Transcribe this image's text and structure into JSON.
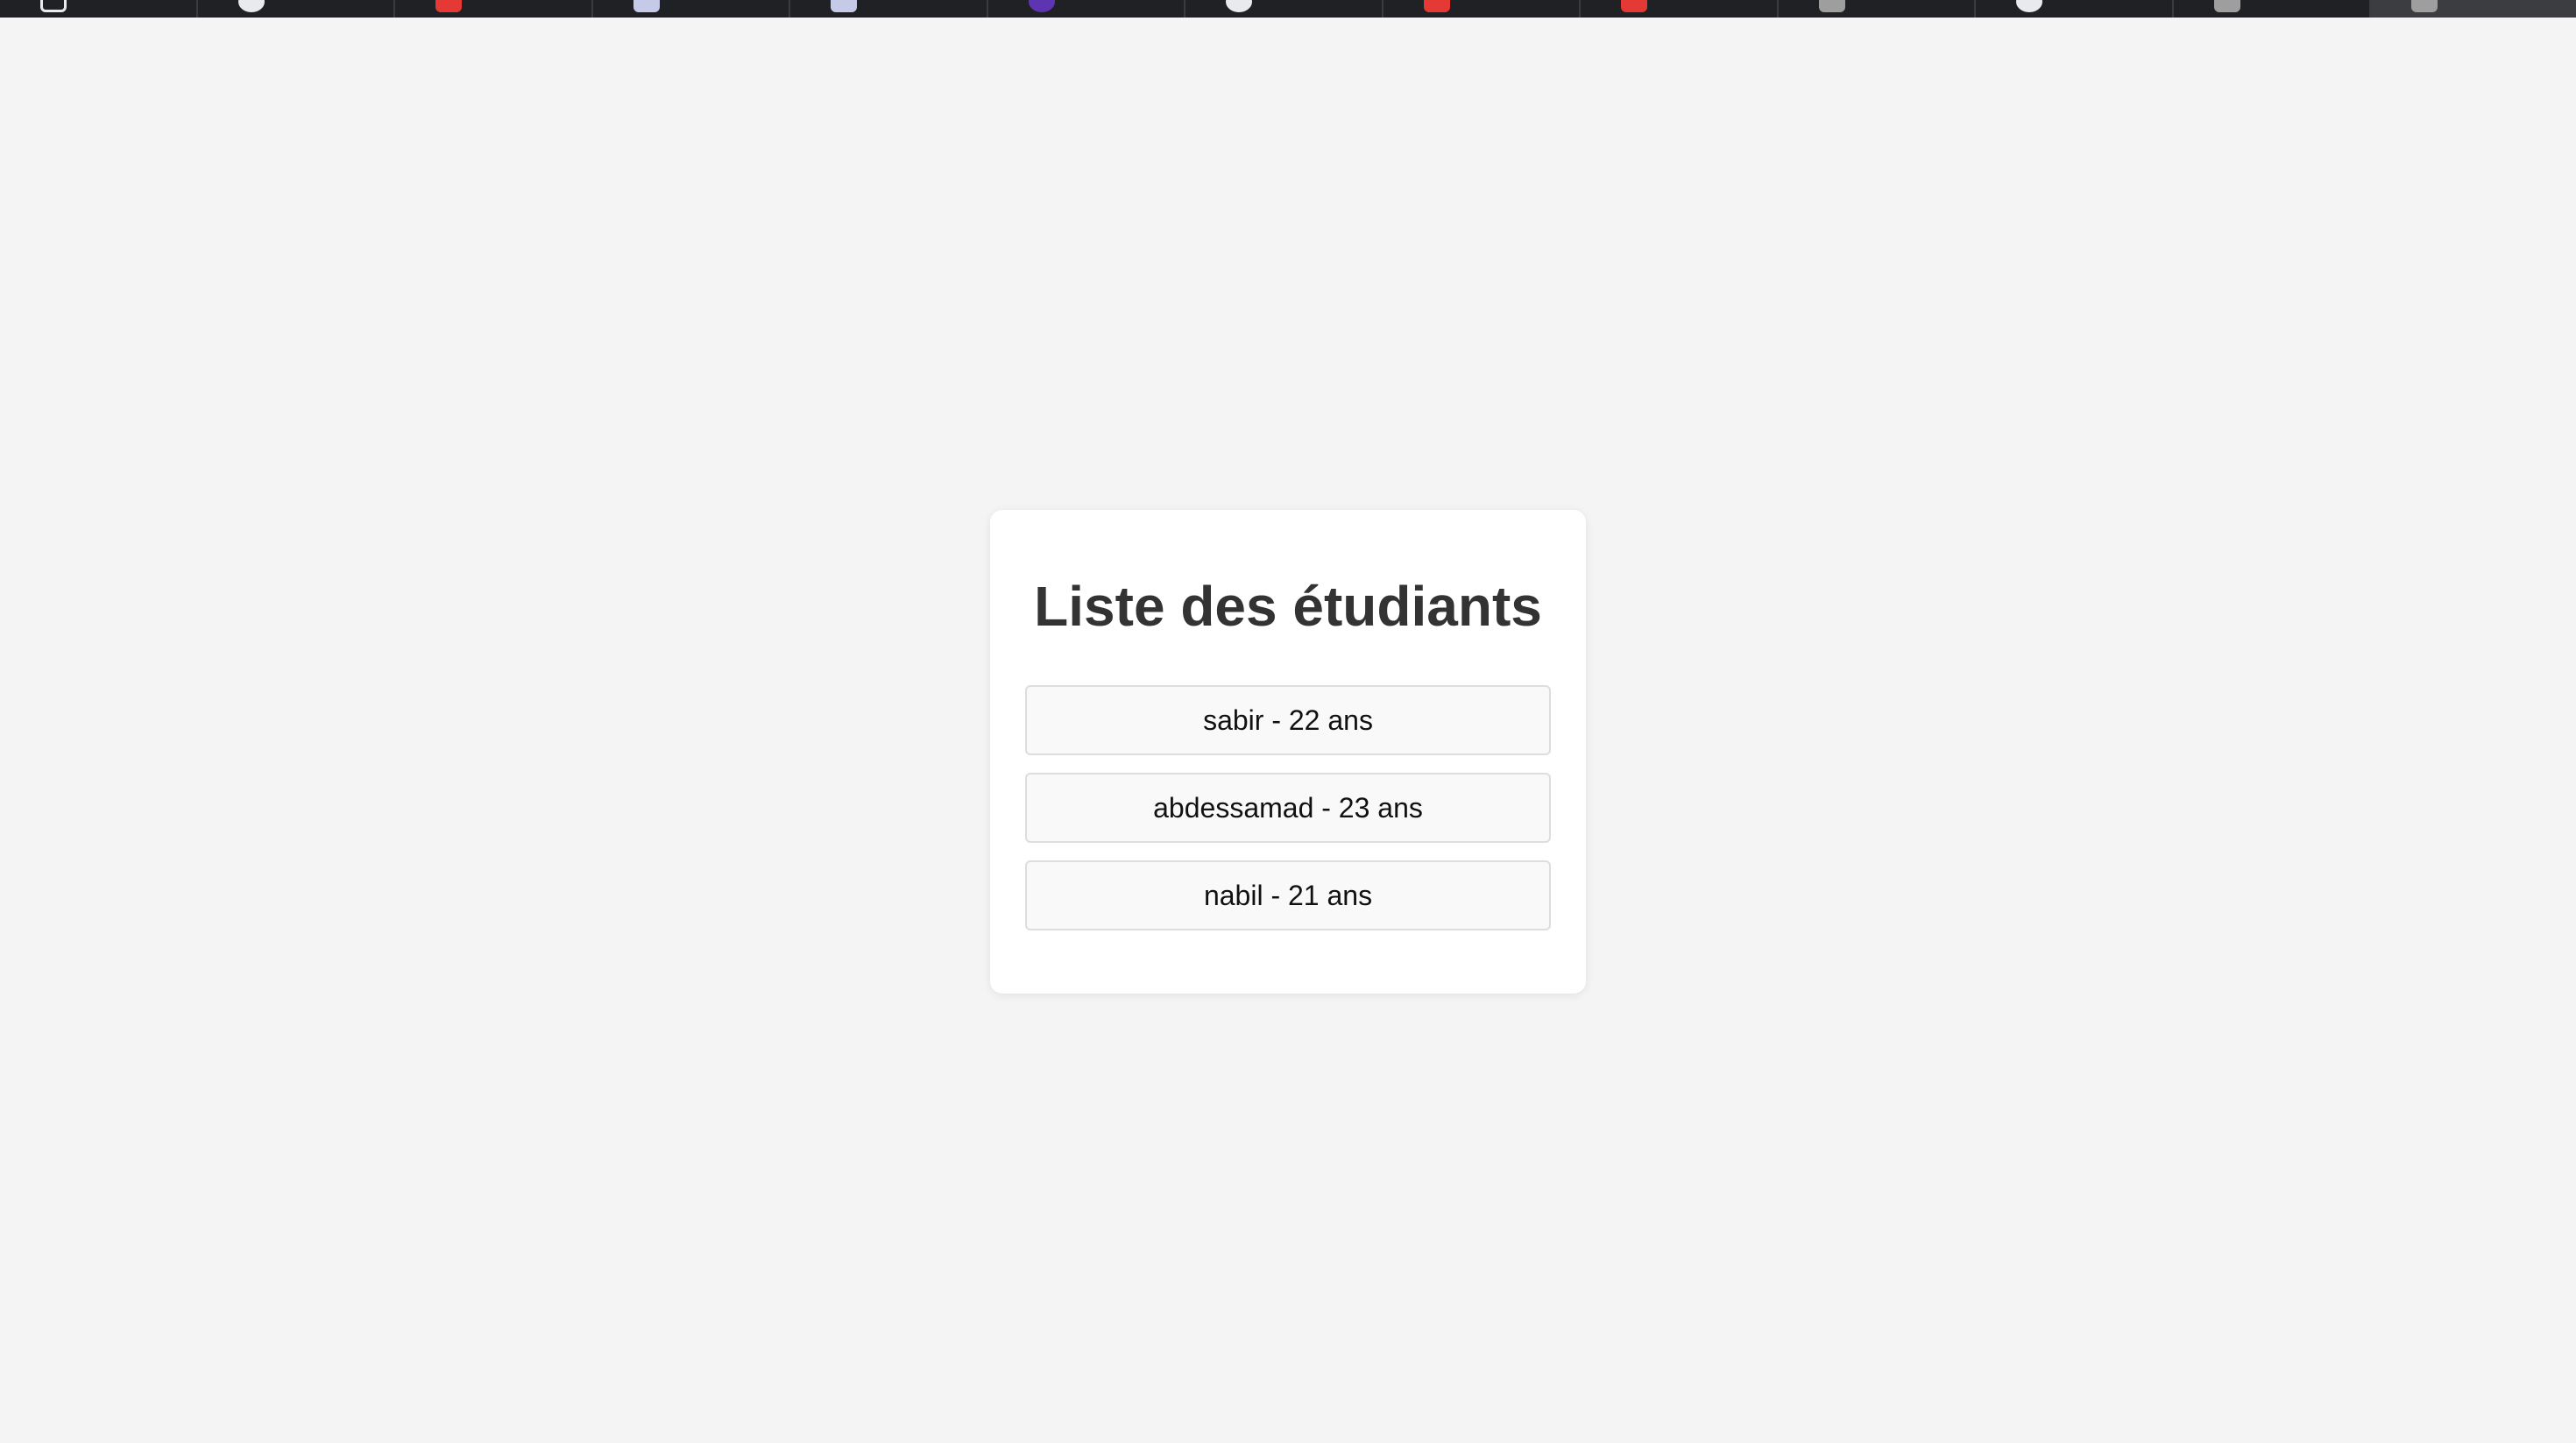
{
  "browser": {
    "tabs": [
      {
        "favicon": "page-icon",
        "color": "#e8eaed"
      },
      {
        "favicon": "chatgpt-icon",
        "color": "#e8eaed"
      },
      {
        "favicon": "youtube-icon",
        "color": "#e53935"
      },
      {
        "favicon": "app-icon",
        "color": "#c5cae9"
      },
      {
        "favicon": "app-icon",
        "color": "#c5cae9"
      },
      {
        "favicon": "globe-icon",
        "color": "#5e35b1"
      },
      {
        "favicon": "chatgpt-icon",
        "color": "#e8eaed"
      },
      {
        "favicon": "youtube-icon",
        "color": "#e53935"
      },
      {
        "favicon": "youtube-icon",
        "color": "#e53935"
      },
      {
        "favicon": "generic-icon",
        "color": "#9e9e9e"
      },
      {
        "favicon": "chatgpt-icon",
        "color": "#e8eaed"
      },
      {
        "favicon": "generic-icon",
        "color": "#9e9e9e"
      },
      {
        "favicon": "generic-icon",
        "color": "#9e9e9e",
        "active": true
      }
    ]
  },
  "main": {
    "title": "Liste des étudiants",
    "students": [
      {
        "label": "sabir - 22 ans"
      },
      {
        "label": "abdessamad - 23 ans"
      },
      {
        "label": "nabil - 21 ans"
      }
    ]
  },
  "colors": {
    "page_background": "#f4f4f4",
    "card_background": "#ffffff",
    "title_text": "#333333",
    "item_background": "#f9f9f9",
    "item_border": "#dddddd"
  }
}
